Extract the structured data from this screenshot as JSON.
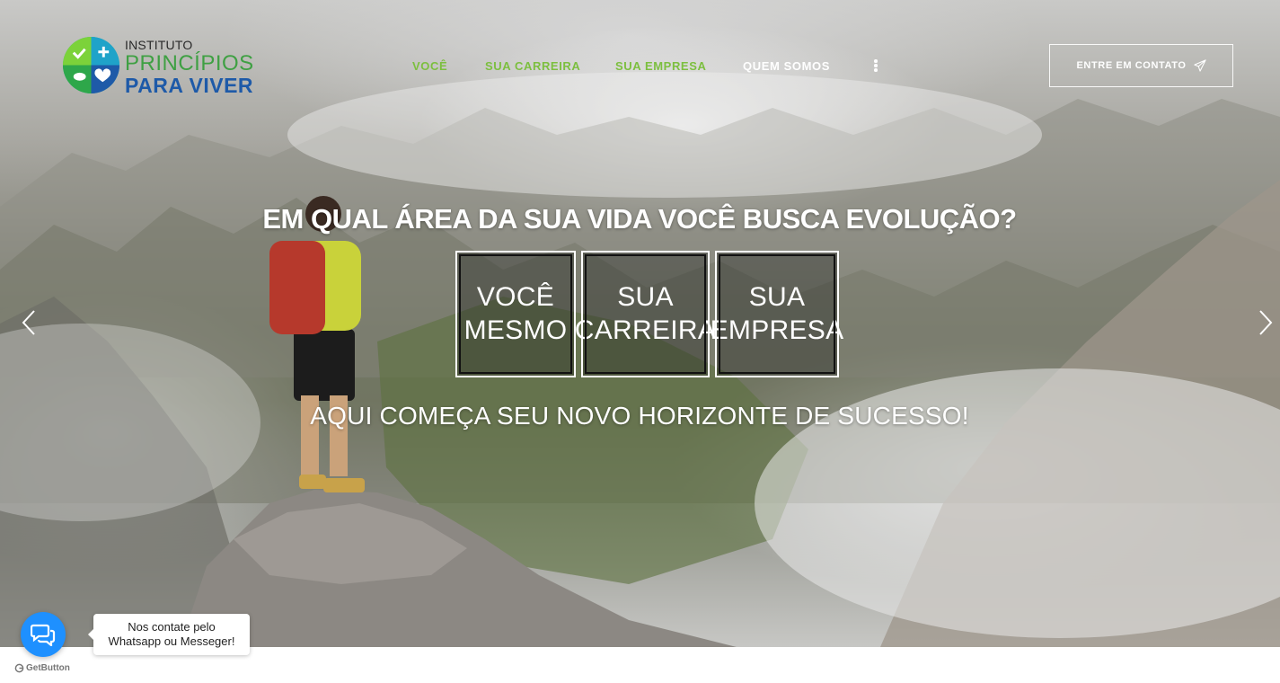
{
  "brand": {
    "line1": "INSTITUTO",
    "line2": "PRINCÍPIOS",
    "line3": "PARA VIVER",
    "colors": {
      "green": "#3fa043",
      "blue": "#1e5aa8",
      "teal": "#1fb6a6",
      "lime": "#7cd23a"
    }
  },
  "nav": {
    "items": [
      {
        "label": "VOCÊ",
        "color": "#7cbf3f"
      },
      {
        "label": "SUA CARREIRA",
        "color": "#7cbf3f"
      },
      {
        "label": "SUA EMPRESA",
        "color": "#7cbf3f"
      },
      {
        "label": "QUEM SOMOS",
        "color": "#ffffff"
      }
    ],
    "more_icon": "kebab-vertical-icon",
    "cta_label": "ENTRE EM CONTATO",
    "cta_icon": "paper-plane-icon"
  },
  "hero": {
    "headline": "EM QUAL ÁREA DA SUA VIDA VOCÊ BUSCA EVOLUÇÃO?",
    "choices": [
      {
        "line1": "VOCÊ",
        "line2": "MESMO"
      },
      {
        "line1": "SUA",
        "line2": "CARREIRA"
      },
      {
        "line1": "SUA",
        "line2": "EMPRESA"
      }
    ],
    "subline": "AQUI COMEÇA SEU NOVO HORIZONTE DE SUCESSO!",
    "prev_icon": "chevron-left-icon",
    "next_icon": "chevron-right-icon"
  },
  "chat": {
    "button_icon": "chat-bubbles-icon",
    "button_color": "#1e90ff",
    "bubble_line1": "Nos contate pelo",
    "bubble_line2": "Whatsapp ou Messeger!",
    "credit": "GetButton"
  }
}
